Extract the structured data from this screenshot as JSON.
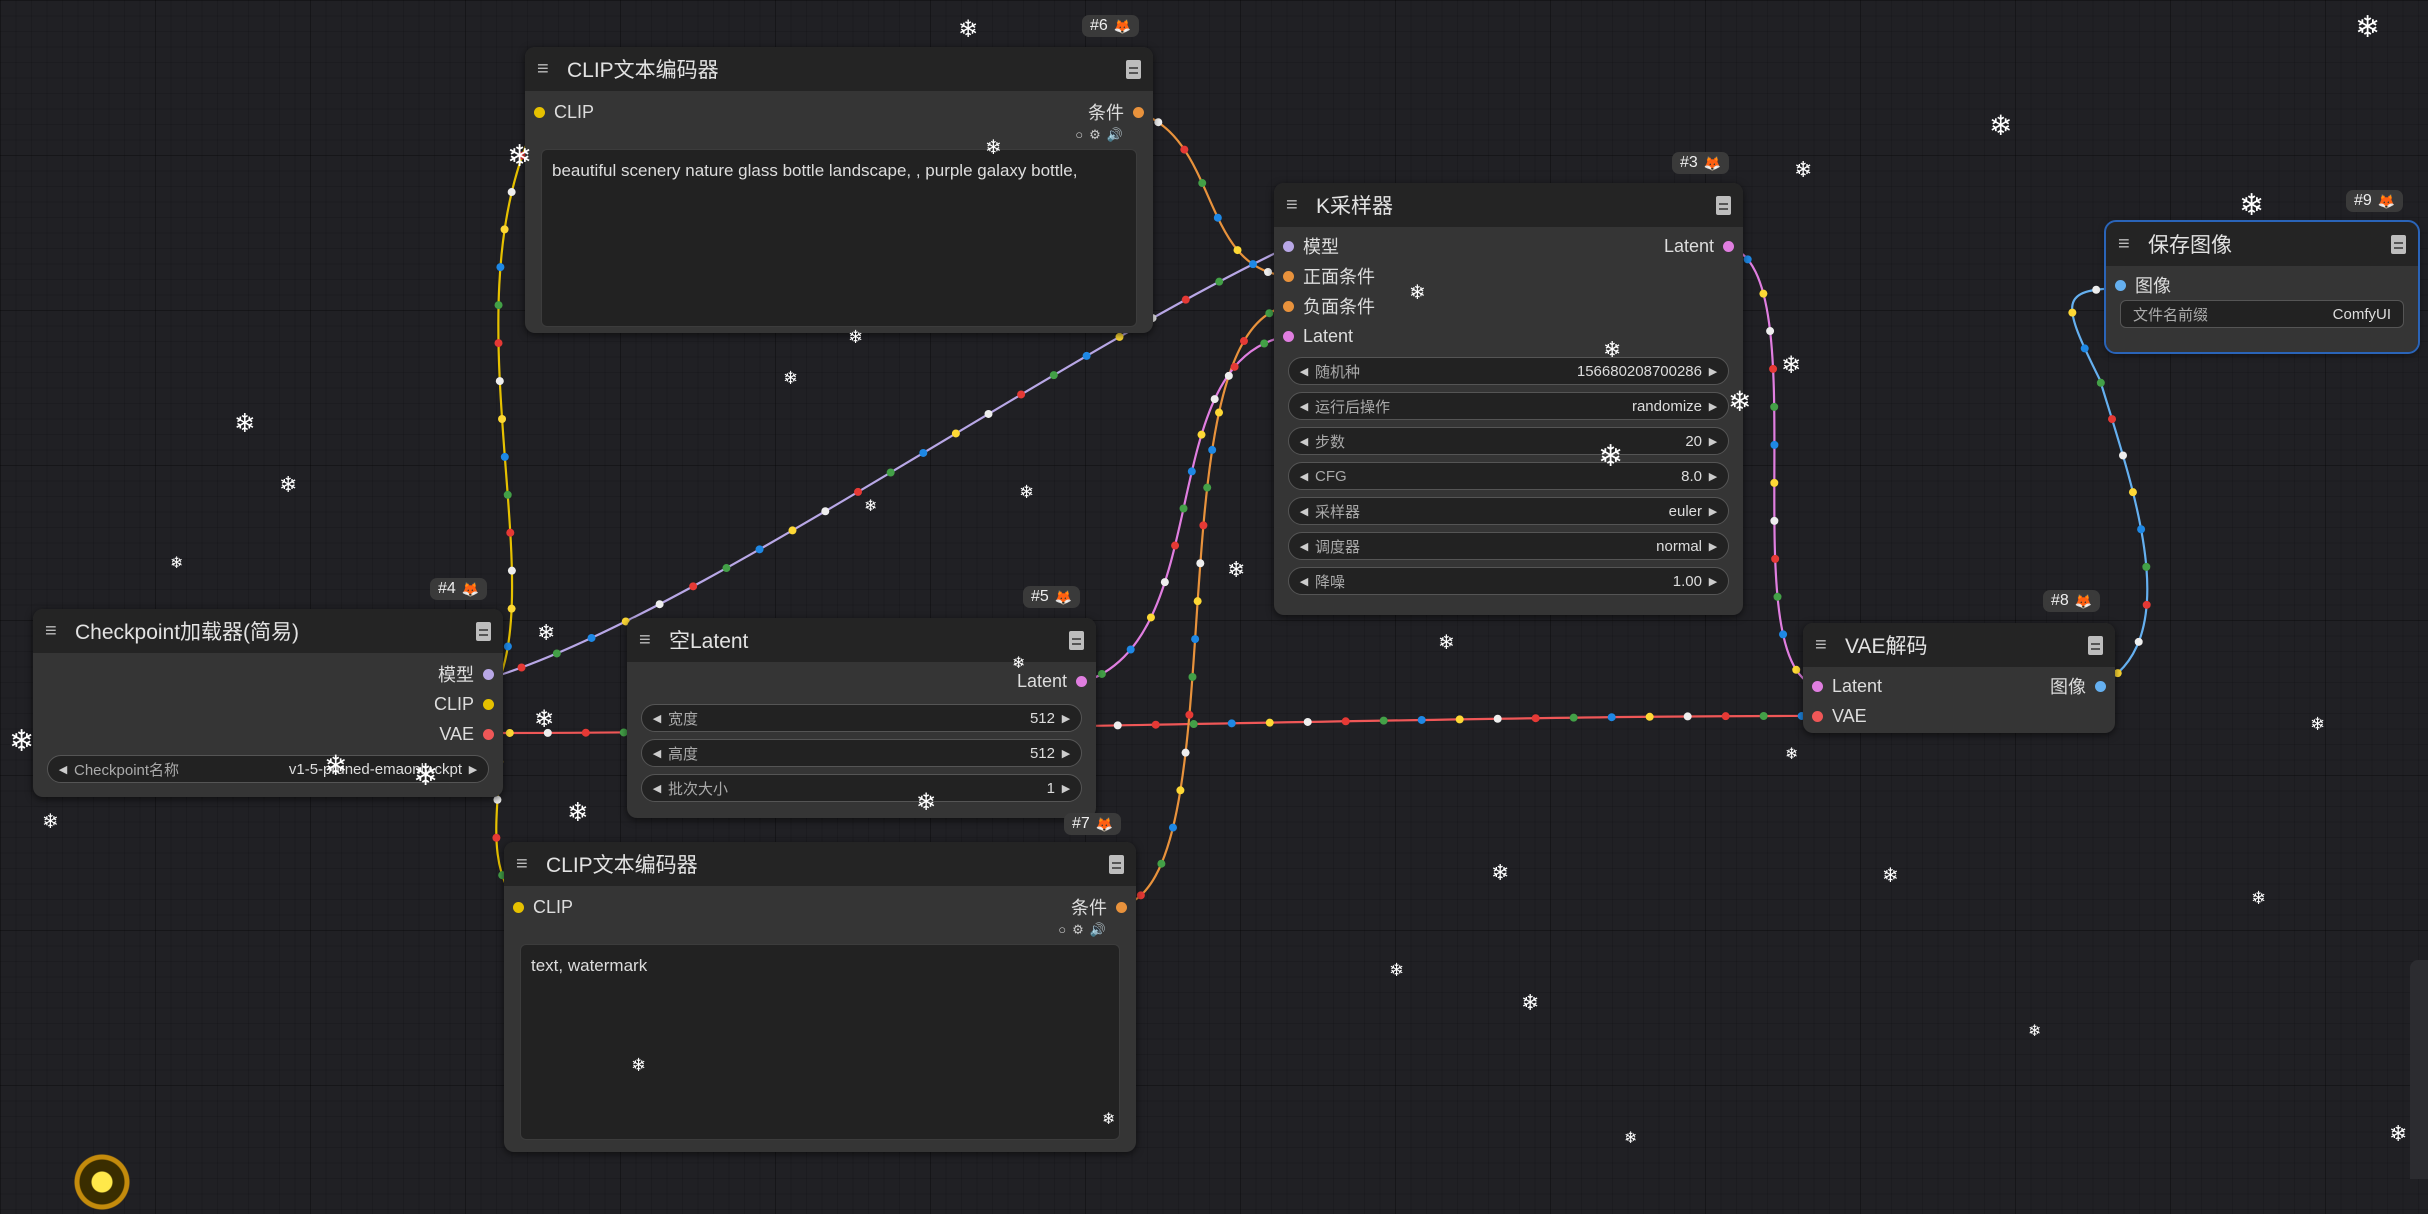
{
  "colors": {
    "clip": "#e6c100",
    "model": "#b8a7e6",
    "conditioning": "#e8923c",
    "latent": "#e07ee0",
    "vae": "#ef5757",
    "image": "#65b0f0",
    "selected_outline": "#2a64b8"
  },
  "nodes": {
    "n6": {
      "id": "#6",
      "title": "CLIP文本编码器",
      "input": "CLIP",
      "output": "条件",
      "text": "beautiful scenery nature glass bottle landscape, , purple galaxy bottle,"
    },
    "n3": {
      "id": "#3",
      "title": "K采样器",
      "inputs": [
        "模型",
        "正面条件",
        "负面条件",
        "Latent"
      ],
      "output": "Latent",
      "widgets": [
        {
          "label": "随机种",
          "value": "156680208700286"
        },
        {
          "label": "运行后操作",
          "value": "randomize"
        },
        {
          "label": "步数",
          "value": "20"
        },
        {
          "label": "CFG",
          "value": "8.0"
        },
        {
          "label": "采样器",
          "value": "euler"
        },
        {
          "label": "调度器",
          "value": "normal"
        },
        {
          "label": "降噪",
          "value": "1.00"
        }
      ]
    },
    "n9": {
      "id": "#9",
      "title": "保存图像",
      "input": "图像",
      "widget": {
        "label": "文件名前缀",
        "value": "ComfyUI"
      }
    },
    "n4": {
      "id": "#4",
      "title": "Checkpoint加载器(简易)",
      "outputs": [
        "模型",
        "CLIP",
        "VAE"
      ],
      "widget": {
        "label": "Checkpoint名称",
        "value": "v1-5-pruned-emaonly.ckpt"
      }
    },
    "n5": {
      "id": "#5",
      "title": "空Latent",
      "output": "Latent",
      "widgets": [
        {
          "label": "宽度",
          "value": "512"
        },
        {
          "label": "高度",
          "value": "512"
        },
        {
          "label": "批次大小",
          "value": "1"
        }
      ]
    },
    "n8": {
      "id": "#8",
      "title": "VAE解码",
      "inputs": [
        "Latent",
        "VAE"
      ],
      "output": "图像"
    },
    "n7": {
      "id": "#7",
      "title": "CLIP文本编码器",
      "input": "CLIP",
      "output": "条件",
      "text": "text, watermark"
    }
  },
  "icons": {
    "menu": "hamburger-icon",
    "doc": "document-icon",
    "badge": "fox-icon",
    "snow": "snowflake-icon",
    "widget_left": "arrow-left-icon",
    "widget_right": "arrow-right-icon"
  }
}
